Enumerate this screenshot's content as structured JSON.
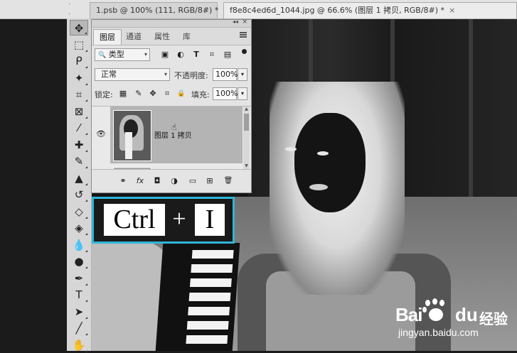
{
  "document_tabs": [
    {
      "label": "1.psb @ 100% (111, RGB/8#) *",
      "close": "×"
    },
    {
      "label": "f8e8c4ed6d_1044.jpg @ 66.6% (图层 1 拷贝, RGB/8#) *",
      "close": "×"
    }
  ],
  "toolbar": {
    "tools": [
      {
        "name": "move-tool",
        "glyph": "✥",
        "active": true
      },
      {
        "name": "marquee-tool",
        "glyph": "⬚"
      },
      {
        "name": "lasso-tool",
        "glyph": "ᑭ"
      },
      {
        "name": "magic-wand-tool",
        "glyph": "✦"
      },
      {
        "name": "crop-tool",
        "glyph": "⌗"
      },
      {
        "name": "frame-tool",
        "glyph": "⊠"
      },
      {
        "name": "eyedropper-tool",
        "glyph": "⁄"
      },
      {
        "name": "healing-brush-tool",
        "glyph": "✚"
      },
      {
        "name": "brush-tool",
        "glyph": "✎"
      },
      {
        "name": "clone-stamp-tool",
        "glyph": "▲"
      },
      {
        "name": "history-brush-tool",
        "glyph": "↺"
      },
      {
        "name": "eraser-tool",
        "glyph": "◇"
      },
      {
        "name": "paint-bucket-tool",
        "glyph": "◈"
      },
      {
        "name": "blur-tool",
        "glyph": "💧"
      },
      {
        "name": "dodge-tool",
        "glyph": "●"
      },
      {
        "name": "pen-tool",
        "glyph": "✒"
      },
      {
        "name": "type-tool",
        "glyph": "T"
      },
      {
        "name": "path-selection-tool",
        "glyph": "➤"
      },
      {
        "name": "line-tool",
        "glyph": "╱"
      },
      {
        "name": "hand-tool",
        "glyph": "✋"
      }
    ]
  },
  "layers_panel": {
    "collapse_glyph": "◂◂",
    "close_glyph": "×",
    "tabs": [
      {
        "label": "图层",
        "active": true
      },
      {
        "label": "通道"
      },
      {
        "label": "属性"
      },
      {
        "label": "库"
      }
    ],
    "filter": {
      "value": "类型",
      "search_glyph": "🔍",
      "caret": "▾"
    },
    "filter_icons": [
      {
        "name": "pixel-filter-icon",
        "glyph": "▣"
      },
      {
        "name": "adjustment-filter-icon",
        "glyph": "◐"
      },
      {
        "name": "type-filter-icon",
        "glyph": "T"
      },
      {
        "name": "shape-filter-icon",
        "glyph": "⌗"
      },
      {
        "name": "smart-object-filter-icon",
        "glyph": "▤"
      }
    ],
    "blend_mode": {
      "value": "正常",
      "caret": "▾"
    },
    "opacity": {
      "label": "不透明度:",
      "value": "100%",
      "caret": "▾"
    },
    "lock": {
      "label": "锁定:",
      "icons": [
        {
          "name": "lock-transparent-icon",
          "glyph": "▦"
        },
        {
          "name": "lock-pixels-icon",
          "glyph": "✎"
        },
        {
          "name": "lock-position-icon",
          "glyph": "✥"
        },
        {
          "name": "lock-artboard-icon",
          "glyph": "⌗"
        },
        {
          "name": "lock-all-icon",
          "glyph": "🔒"
        }
      ]
    },
    "fill": {
      "label": "填充:",
      "value": "100%",
      "caret": "▾"
    },
    "layer": {
      "name": "图层 1 拷贝",
      "eye_glyph": "👁"
    },
    "bottom_icons": [
      {
        "name": "link-layers-icon",
        "glyph": "⚭"
      },
      {
        "name": "layer-style-icon",
        "glyph": "fx"
      },
      {
        "name": "layer-mask-icon",
        "glyph": "◘"
      },
      {
        "name": "adjustment-layer-icon",
        "glyph": "◑"
      },
      {
        "name": "group-icon",
        "glyph": "▭"
      },
      {
        "name": "new-layer-icon",
        "glyph": "⊞"
      },
      {
        "name": "delete-layer-icon",
        "glyph": "🗑"
      }
    ]
  },
  "shortcut": {
    "key1": "Ctrl",
    "plus": "+",
    "key2": "I"
  },
  "watermark": {
    "brand1": "Bai",
    "brand2": "du",
    "brand3": "经验",
    "url": "jingyan.baidu.com"
  },
  "colors": {
    "accent": "#2eb6d8",
    "panel_bg": "#e4e4e4",
    "toolbar_bg": "#d6d6d6"
  }
}
